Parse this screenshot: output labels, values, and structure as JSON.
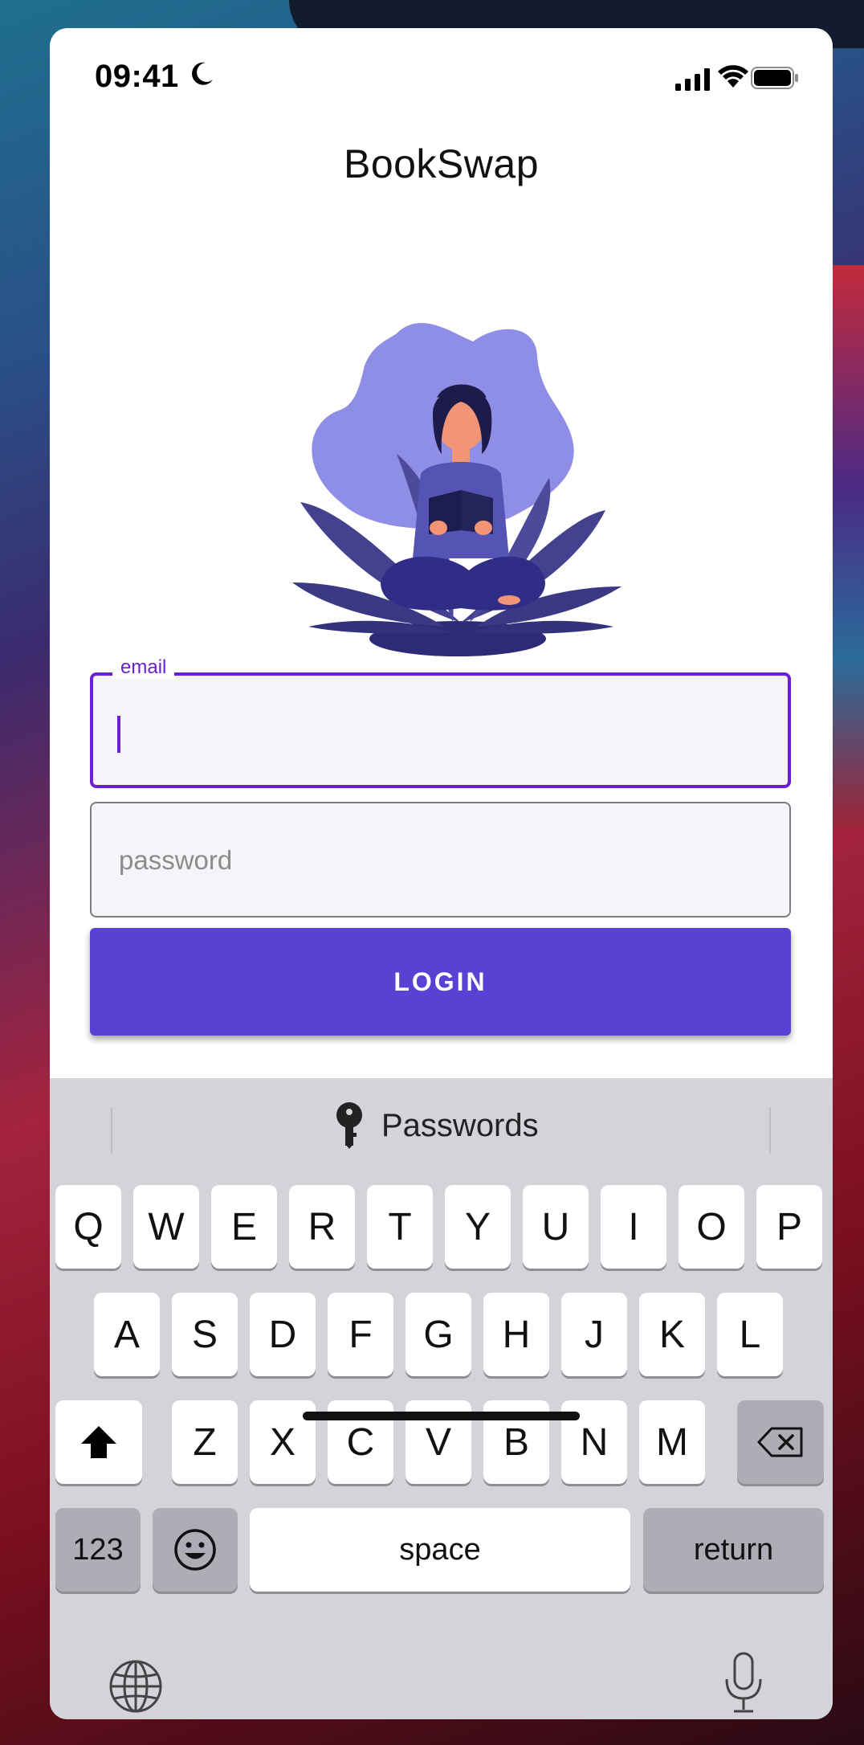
{
  "status_bar": {
    "time": "09:41",
    "icons": [
      "moon-icon",
      "cellular-signal-icon",
      "wifi-icon",
      "battery-icon"
    ]
  },
  "app": {
    "title": "BookSwap",
    "illustration": "woman-reading-book-illustration"
  },
  "form": {
    "email": {
      "label": "email",
      "value": "",
      "focused": true
    },
    "password": {
      "placeholder": "password",
      "value": ""
    },
    "login_button": "LOGIN"
  },
  "keyboard": {
    "suggestion": {
      "icon": "key-icon",
      "label": "Passwords"
    },
    "rows": [
      [
        "Q",
        "W",
        "E",
        "R",
        "T",
        "Y",
        "U",
        "I",
        "O",
        "P"
      ],
      [
        "A",
        "S",
        "D",
        "F",
        "G",
        "H",
        "J",
        "K",
        "L"
      ],
      [
        "Z",
        "X",
        "C",
        "V",
        "B",
        "N",
        "M"
      ]
    ],
    "numbers_key": "123",
    "space_key": "space",
    "return_key": "return",
    "special_icons": [
      "shift-icon",
      "backspace-icon",
      "emoji-icon",
      "globe-icon",
      "microphone-icon"
    ]
  },
  "colors": {
    "accent": "#6a1fd0",
    "button": "#5b41d3",
    "keyboard_bg": "#d3d3da"
  }
}
